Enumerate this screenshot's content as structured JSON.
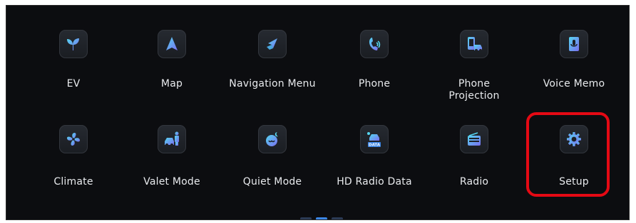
{
  "colors": {
    "accent_gradient_start": "#55d6f0",
    "accent_gradient_end": "#7a6ff0",
    "highlight": "#e50914",
    "label": "#e8eaed",
    "background": "#0c0d10"
  },
  "apps": [
    {
      "label": "EV",
      "icon": "leaf-icon"
    },
    {
      "label": "Map",
      "icon": "navigation-arrow-icon"
    },
    {
      "label": "Navigation Menu",
      "icon": "compass-icon"
    },
    {
      "label": "Phone",
      "icon": "phone-icon"
    },
    {
      "label": "Phone\nProjection",
      "icon": "phone-projection-icon"
    },
    {
      "label": "Voice Memo",
      "icon": "voice-memo-icon"
    },
    {
      "label": "Climate",
      "icon": "fan-icon"
    },
    {
      "label": "Valet Mode",
      "icon": "valet-icon"
    },
    {
      "label": "Quiet Mode",
      "icon": "quiet-mode-icon"
    },
    {
      "label": "HD Radio Data",
      "icon": "hd-radio-data-icon",
      "badge": "DATA"
    },
    {
      "label": "Radio",
      "icon": "radio-icon"
    },
    {
      "label": "Setup",
      "icon": "gear-icon",
      "highlighted": true
    }
  ],
  "pagination": {
    "pages": 3,
    "current": 2
  }
}
